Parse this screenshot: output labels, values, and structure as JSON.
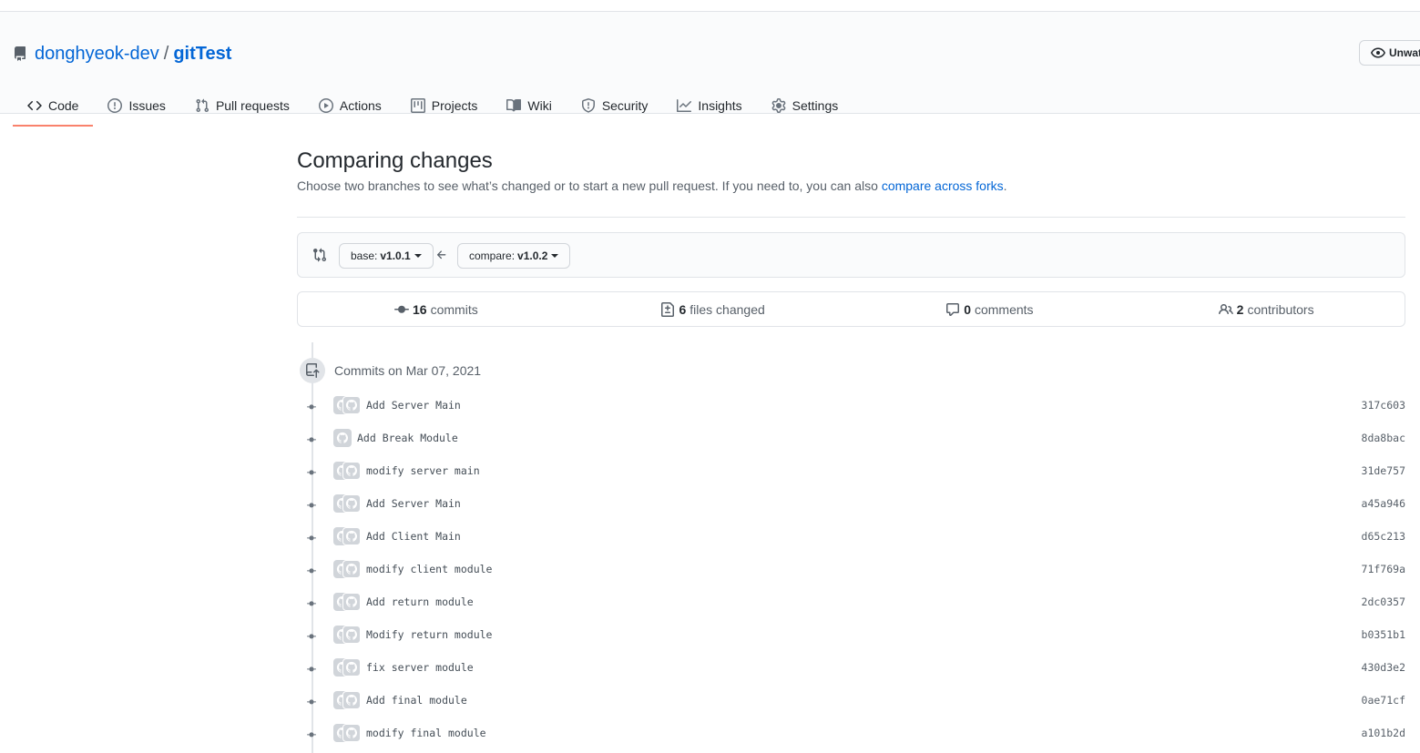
{
  "repo": {
    "owner": "donghyeok-dev",
    "separator": "/",
    "name": "gitTest"
  },
  "watch_button": "Unwat",
  "tabs": [
    {
      "label": "Code",
      "icon": "code-icon",
      "selected": true
    },
    {
      "label": "Issues",
      "icon": "issue-icon"
    },
    {
      "label": "Pull requests",
      "icon": "pull-request-icon"
    },
    {
      "label": "Actions",
      "icon": "play-icon"
    },
    {
      "label": "Projects",
      "icon": "project-icon"
    },
    {
      "label": "Wiki",
      "icon": "book-icon"
    },
    {
      "label": "Security",
      "icon": "shield-icon"
    },
    {
      "label": "Insights",
      "icon": "graph-icon"
    },
    {
      "label": "Settings",
      "icon": "gear-icon"
    }
  ],
  "compare": {
    "title": "Comparing changes",
    "description": "Choose two branches to see what’s changed or to start a new pull request. If you need to, you can also ",
    "link": "compare across forks",
    "link_suffix": ".",
    "base_label": "base:",
    "base_value": "v1.0.1",
    "compare_label": "compare:",
    "compare_value": "v1.0.2"
  },
  "stats": {
    "commits_count": "16",
    "commits_label": "commits",
    "files_count": "6",
    "files_label": "files changed",
    "comments_count": "0",
    "comments_label": "comments",
    "contributors_count": "2",
    "contributors_label": "contributors"
  },
  "commits_group": "Commits on Mar 07, 2021",
  "commits": [
    {
      "message": "Add Server Main",
      "sha": "317c603",
      "avatars": 2
    },
    {
      "message": "Add Break Module",
      "sha": "8da8bac",
      "avatars": 1
    },
    {
      "message": "modify server main",
      "sha": "31de757",
      "avatars": 2
    },
    {
      "message": "Add Server Main",
      "sha": "a45a946",
      "avatars": 2
    },
    {
      "message": "Add Client Main",
      "sha": "d65c213",
      "avatars": 2
    },
    {
      "message": "modify client module",
      "sha": "71f769a",
      "avatars": 2
    },
    {
      "message": "Add return module",
      "sha": "2dc0357",
      "avatars": 2
    },
    {
      "message": "Modify return module",
      "sha": "b0351b1",
      "avatars": 2
    },
    {
      "message": "fix server module",
      "sha": "430d3e2",
      "avatars": 2
    },
    {
      "message": "Add final module",
      "sha": "0ae71cf",
      "avatars": 2
    },
    {
      "message": "modify final module",
      "sha": "a101b2d",
      "avatars": 2
    }
  ]
}
